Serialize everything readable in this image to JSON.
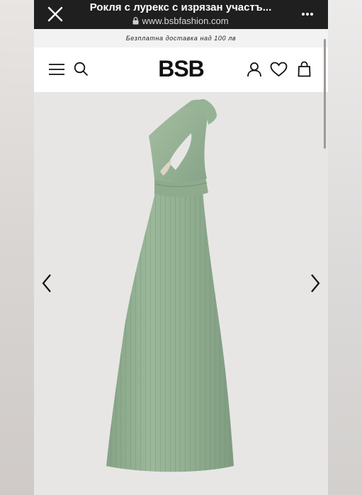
{
  "browser": {
    "page_title": "Рокля с лурекс с изрязан участъ...",
    "url": "www.bsbfashion.com"
  },
  "promo": {
    "text": "Безплатна доставка над 100 лв"
  },
  "header": {
    "logo": "BSB"
  },
  "icons": {
    "close": "close-icon",
    "lock": "lock-icon",
    "more": "more-icon",
    "menu": "hamburger-menu-icon",
    "search": "search-icon",
    "account": "user-icon",
    "wishlist": "heart-icon",
    "bag": "shopping-bag-icon",
    "prev": "chevron-left-icon",
    "next": "chevron-right-icon"
  },
  "colors": {
    "topbar": "#1f1f1f",
    "dress": "#8fac8f",
    "product_bg": "#e7e6e5"
  }
}
